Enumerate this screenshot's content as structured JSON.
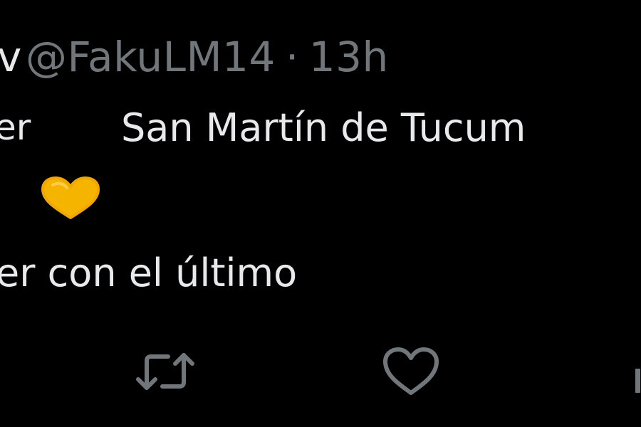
{
  "tweet": {
    "author_name_fragment": "v",
    "handle": "@FakuLM14",
    "separator": "·",
    "time_ago": "13h",
    "line1_left": "er",
    "line1_right": "San Martín de Tucum",
    "line2": "er con el último"
  },
  "icons": {
    "emoji": "yellow-heart-emoji-icon",
    "retweet": "retweet-icon",
    "like": "heart-outline-icon",
    "partial": "share-icon"
  },
  "colors": {
    "background": "#000000",
    "text_primary": "#e7e9ea",
    "text_secondary": "#71767b",
    "emoji_yellow": "#f5b400"
  }
}
